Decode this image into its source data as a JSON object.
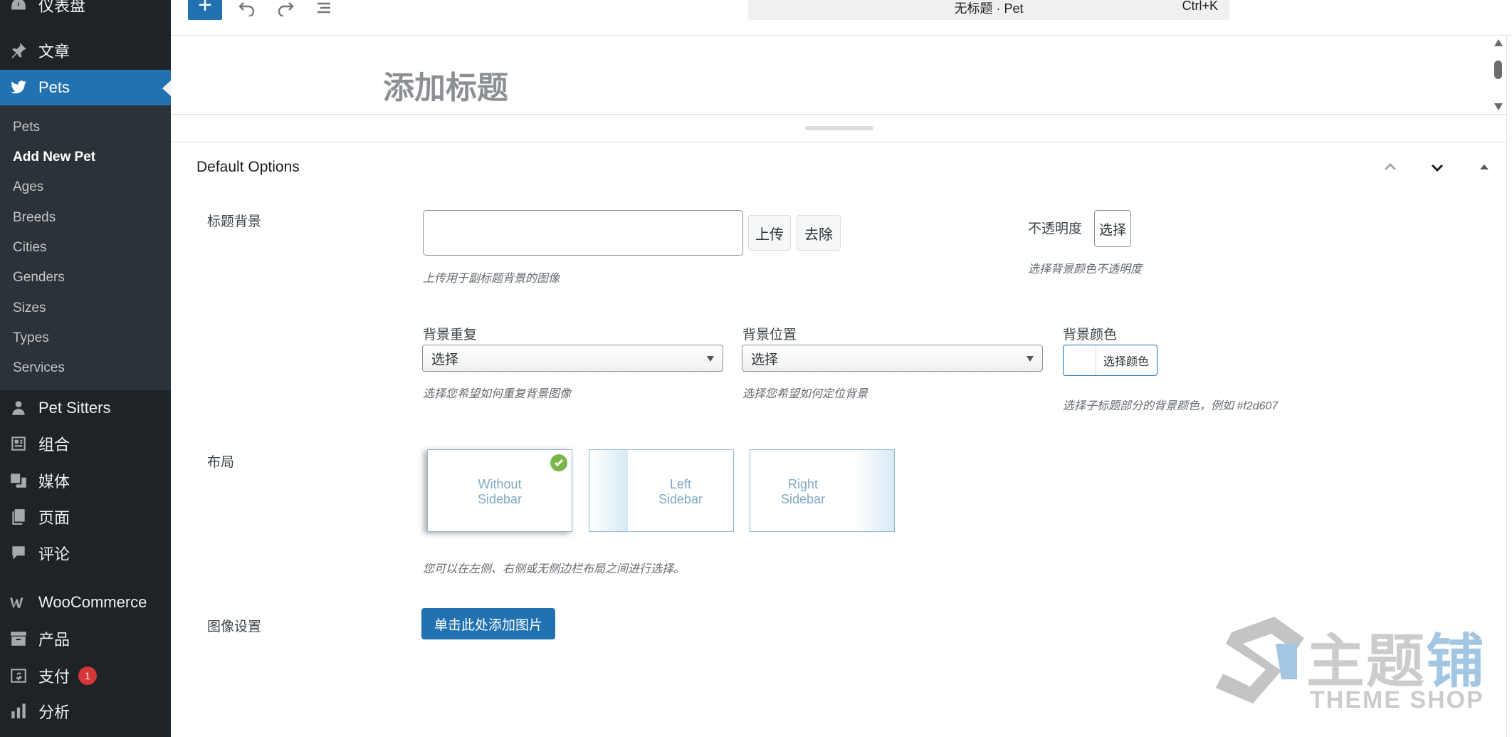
{
  "sidebar": {
    "items": [
      {
        "label": "仪表盘",
        "icon": "dashboard-icon"
      },
      {
        "label": "文章",
        "icon": "pin-icon"
      },
      {
        "label": "Pets",
        "icon": "twitter-bird-icon"
      },
      {
        "label": "Pet Sitters",
        "icon": "users-icon"
      },
      {
        "label": "组合",
        "icon": "portfolio-icon"
      },
      {
        "label": "媒体",
        "icon": "media-icon"
      },
      {
        "label": "页面",
        "icon": "pages-icon"
      },
      {
        "label": "评论",
        "icon": "comment-icon"
      },
      {
        "label": "WooCommerce",
        "icon": "woocommerce-icon"
      },
      {
        "label": "产品",
        "icon": "archive-icon"
      },
      {
        "label": "支付",
        "icon": "payment-icon",
        "badge": "1"
      },
      {
        "label": "分析",
        "icon": "chart-bar-icon"
      }
    ],
    "submenu": [
      "Pets",
      "Add New Pet",
      "Ages",
      "Breeds",
      "Cities",
      "Genders",
      "Sizes",
      "Types",
      "Services"
    ],
    "active_item": "Pets",
    "current_submenu": "Add New Pet"
  },
  "toolbar": {
    "add_label": "+",
    "command_center_title": "无标题 · Pet",
    "command_center_shortcut": "Ctrl+K"
  },
  "editor": {
    "title_placeholder": "添加标题"
  },
  "metabox": {
    "title": "Default Options",
    "title_bg_label": "标题背景",
    "upload_label": "上传",
    "remove_label": "去除",
    "title_bg_desc": "上传用于副标题背景的图像",
    "opacity_label": "不透明度",
    "opacity_button": "选择",
    "opacity_desc": "选择背景颜色不透明度",
    "bg_repeat_label": "背景重复",
    "bg_repeat_value": "选择",
    "bg_repeat_desc": "选择您希望如何重复背景图像",
    "bg_position_label": "背景位置",
    "bg_position_value": "选择",
    "bg_position_desc": "选择您希望如何定位背景",
    "bg_color_label": "背景颜色",
    "bg_color_button": "选择颜色",
    "bg_color_desc": "选择子标题部分的背景颜色，例如 #f2d607",
    "layout_label": "布局",
    "layout_options": [
      "Without\nSidebar",
      "Left\nSidebar",
      "Right\nSidebar"
    ],
    "layout_selected": "Without Sidebar",
    "layout_desc": "您可以在左侧、右侧或无侧边栏布局之间进行选择。",
    "image_settings_label": "图像设置",
    "add_image_button": "单击此处添加图片"
  },
  "watermark": {
    "cn_gray": "主题",
    "cn_blue": "铺",
    "en": "THEME SHOP"
  },
  "colors": {
    "sidebar_bg": "#1d2327",
    "submenu_bg": "#2c3338",
    "accent": "#2271b1",
    "badge": "#d63638",
    "check": "#7ab648"
  }
}
